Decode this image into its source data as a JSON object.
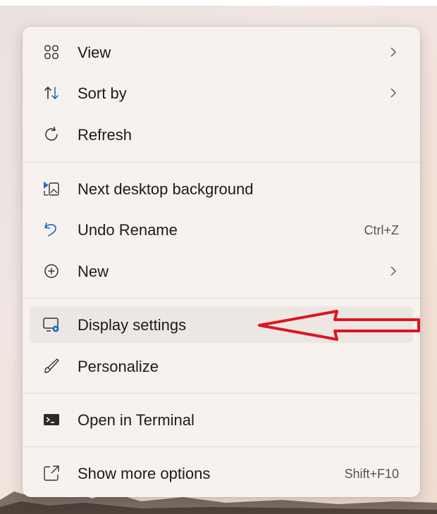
{
  "context_menu": {
    "items": [
      {
        "label": "View",
        "icon": "view-grid-icon",
        "submenu": true
      },
      {
        "label": "Sort by",
        "icon": "sort-icon",
        "submenu": true
      },
      {
        "label": "Refresh",
        "icon": "refresh-icon"
      },
      {
        "label": "Next desktop background",
        "icon": "next-background-icon"
      },
      {
        "label": "Undo Rename",
        "icon": "undo-icon",
        "shortcut": "Ctrl+Z"
      },
      {
        "label": "New",
        "icon": "new-plus-icon",
        "submenu": true
      },
      {
        "label": "Display settings",
        "icon": "display-settings-icon",
        "highlighted": true
      },
      {
        "label": "Personalize",
        "icon": "personalize-brush-icon"
      },
      {
        "label": "Open in Terminal",
        "icon": "terminal-icon"
      },
      {
        "label": "Show more options",
        "icon": "show-more-options-icon",
        "shortcut": "Shift+F10"
      }
    ]
  },
  "annotation": {
    "type": "red-arrow",
    "color": "#e0141e",
    "points_to": "Display settings"
  },
  "colors": {
    "menu_bg": "#f8f2ef",
    "hover_bg": "#ede7e4",
    "icon_blue": "#1a6fc7",
    "text": "#1b1b1b"
  }
}
